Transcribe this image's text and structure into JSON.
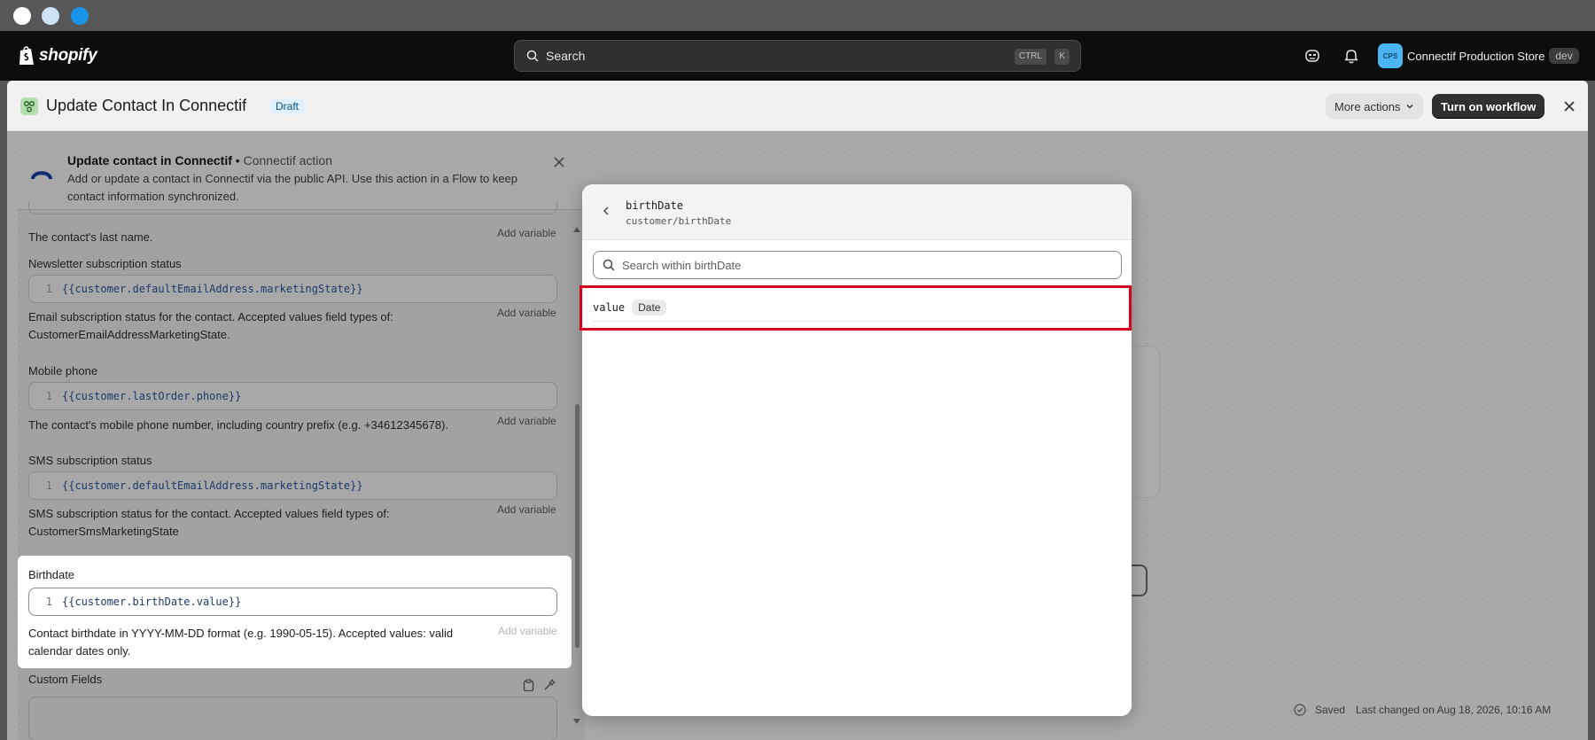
{
  "window": {
    "controls": [
      "close",
      "minimize",
      "maximize"
    ]
  },
  "topbar": {
    "brand": "shopify",
    "search_label": "Search",
    "shortcut_ctrl": "CTRL",
    "shortcut_key": "K",
    "store_initials": "CPS",
    "store_name": "Connectif Production Store",
    "store_badge": "dev"
  },
  "header": {
    "title": "Update Contact In Connectif",
    "status": "Draft",
    "more_actions": "More actions",
    "primary_action": "Turn on workflow"
  },
  "action_panel": {
    "title": "Update contact in Connectif",
    "separator": "•",
    "subtitle": "Connectif action",
    "description": "Add or update a contact in Connectif via the public API. Use this action in a Flow to keep contact information synchronized.",
    "add_variable": "Add variable",
    "fields": [
      {
        "help": "The contact's last name."
      },
      {
        "label": "Newsletter subscription status",
        "line": "1",
        "value": "{{customer.defaultEmailAddress.marketingState}}",
        "help": "Email subscription status for the contact. Accepted values field types of: CustomerEmailAddressMarketingState."
      },
      {
        "label": "Mobile phone",
        "line": "1",
        "value": "{{customer.lastOrder.phone}}",
        "help": "The contact's mobile phone number, including country prefix (e.g. +34612345678)."
      },
      {
        "label": "SMS subscription status",
        "line": "1",
        "value": "{{customer.defaultEmailAddress.marketingState}}",
        "help": "SMS subscription status for the contact. Accepted values field types of: CustomerSmsMarketingState"
      },
      {
        "label": "Birthdate",
        "line": "1",
        "value": "{{customer.birthDate.value}}",
        "help": "Contact birthdate in YYYY-MM-DD format (e.g. 1990-05-15). Accepted values: valid calendar dates only."
      },
      {
        "label": "Custom Fields"
      }
    ]
  },
  "variable_picker": {
    "title": "birthDate",
    "path": "customer/birthDate",
    "search_placeholder": "Search within birthDate",
    "items": [
      {
        "key": "value",
        "type": "Date"
      }
    ]
  },
  "status_bar": {
    "saved": "Saved",
    "last_changed": "Last changed on Aug 18, 2026, 10:16 AM"
  },
  "colors": {
    "highlight": "#d6001c",
    "draft_badge_bg": "#e0f0ff",
    "primary_button": "#303030",
    "store_avatar": "#4db4f2"
  }
}
